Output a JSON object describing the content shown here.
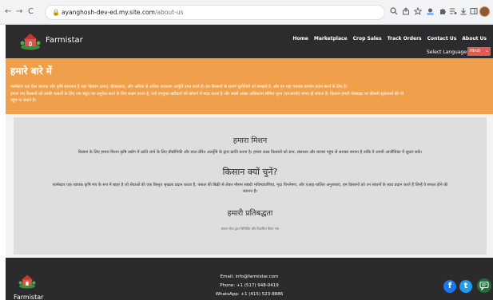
{
  "browser": {
    "url_host": "ayanghosh-dev-ed.my.site.com",
    "url_path": "/about-us",
    "back_glyph": "←",
    "forward_glyph": "→",
    "reload_glyph": "C",
    "lock_glyph": "🔒",
    "icons": [
      "search-icon",
      "share-icon",
      "star-icon",
      "extension-icon",
      "puzzle-icon",
      "media-icon",
      "download-icon",
      "sidepanel-icon",
      "profile-avatar"
    ]
  },
  "header": {
    "brand": "Farmistar",
    "menu": [
      "Home",
      "Marketplace",
      "Crop Sales",
      "Track Orders",
      "Contact Us",
      "About Us"
    ],
    "language_label": "Select Language:",
    "language_value": "Hindi"
  },
  "about": {
    "title": "हमारे बारे में",
    "p1": "फार्मस्टार एक ऐसा व्यापक और कृषि समाधान है जहां किसान उत्पाद, बीजप्रसाद, और अधिक से अधिक उपकरण आपूर्ति प्राप्त करते हैं। हम किसानों के सामने चुनौतियों को समझते हैं, और हम यहां व्यापक समर्थन प्रदान करने के लिए हैं।",
    "p2": "हमारा मंच किसानों को उनकी फसलों के लिए एक क्यू/र का अनुरोध करने के लिए सक्षम करता है, उन्हें उपयुक्त खरीदारों को खोजने में मदद करता है और सबसे अच्छा अधिकतम सीमित मूल्य (एमआरपी) संभव हो सकता है। किसान हमारी वेबसाइट पर कीमती सूचनाओं की भी",
    "p3": "पहुंच पा सकते हैं।"
  },
  "sections": {
    "mission_title": "हमारा मिशन",
    "mission_text": "किसान के लिए हमारा मिशन कृषि उद्योग में क्रांति लाने के लिए प्रौद्योगिकी और डाटा-प्रेरित अंतर्दृष्टि के द्वारा क्रांति करना है। हमारा लक्ष्य किसानों को ज्ञान, संसाधन और बाजार पहुंच से सशक्त बनाना है ताकि वे अपनी आजीविका में सुधार सकें।",
    "why_title": "किसान क्यों चुनें?",
    "why_text_1": "फार्मस्टार एक व्यापक कृषि मंच के रूप में बाहर है जो सेवाओं की एक विस्तृत श्रृंखला प्रदान करता है, फसल की बिक्री से लेकर मौसम संबंधी भविष्यवाणियां, मृदा विश्लेषण, और एआइ-चालित अनुशंसाएं, हम किसानों को उन साधनों के साथ प्रदान करते हैं जिन्हें वे सफल होने की",
    "why_text_2": "जरूरत है।",
    "commit_title": "हमारी प्रतिबद्धता",
    "commit_text": "हमारा सोच द्वारा विनिर्दिष्ट और विकसित किया गया"
  },
  "footer": {
    "brand": "Farmistar",
    "email": "Email: info@farmistar.com",
    "phone": "Phone: +1 (517) 948-0419",
    "whatsapp": "WhatsApp: +1 (415) 523-8886",
    "facebook_glyph": "f",
    "twitter_glyph": "t"
  },
  "colors": {
    "header_bg": "#2c2b2e",
    "about_bg": "#f0a04b",
    "lang_select_bg": "#e35b4f",
    "facebook": "#1877f2",
    "twitter": "#1d9bf0",
    "chat": "#1f6f3a"
  }
}
